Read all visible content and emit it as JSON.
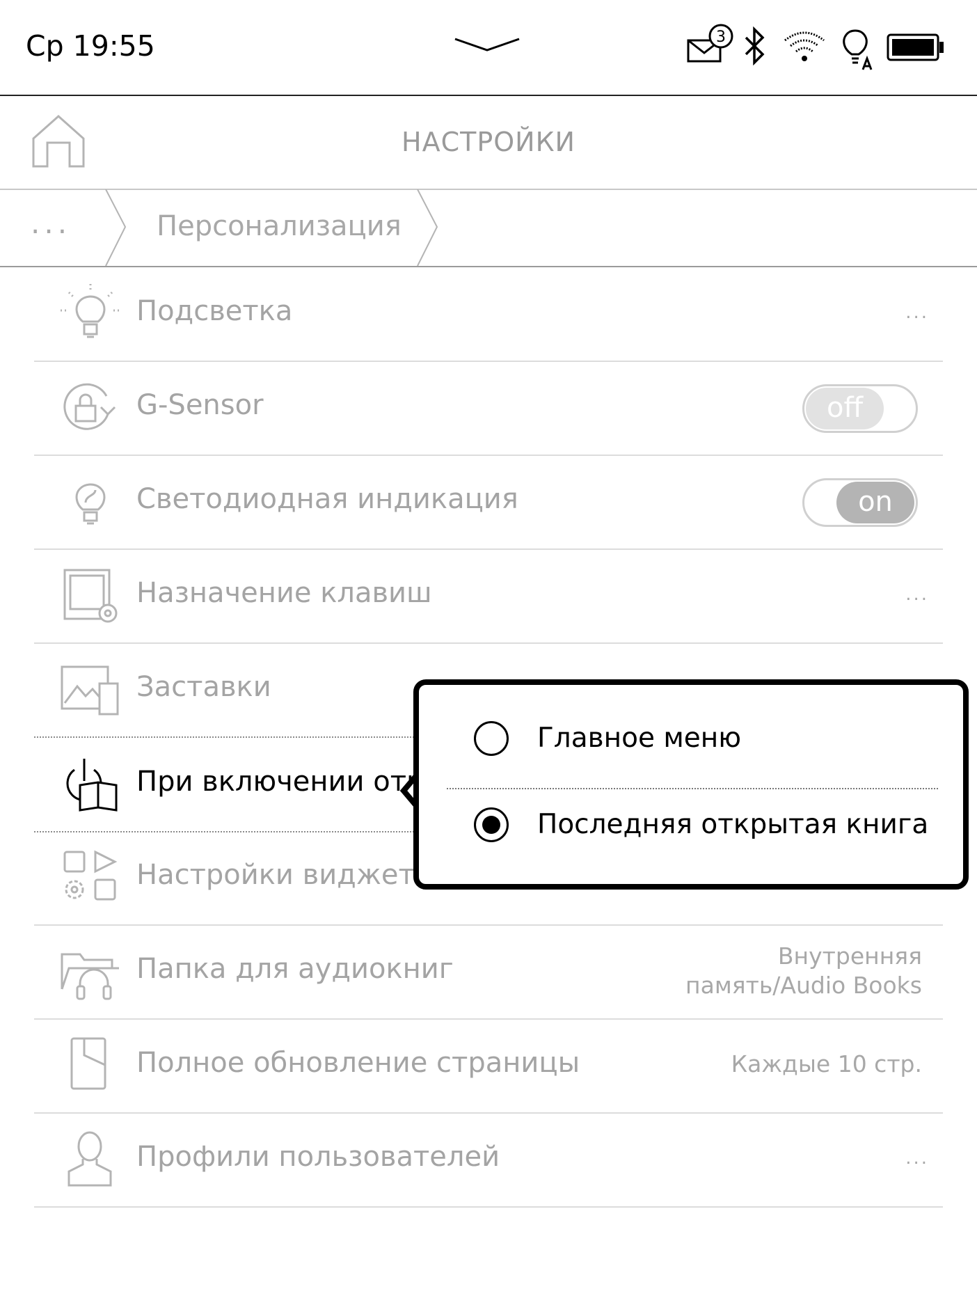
{
  "status": {
    "time": "Ср 19:55",
    "mail_count": "3"
  },
  "header": {
    "title": "НАСТРОЙКИ"
  },
  "breadcrumb": {
    "more": "...",
    "current": "Персонализация"
  },
  "settings": {
    "backlight": {
      "label": "Подсветка",
      "more": "..."
    },
    "gsensor": {
      "label": "G-Sensor",
      "toggle": "off"
    },
    "led": {
      "label": "Светодиодная индикация",
      "toggle": "on"
    },
    "keys": {
      "label": "Назначение клавиш",
      "more": "..."
    },
    "screensavers": {
      "label": "Заставки"
    },
    "on_power": {
      "label": "При включении открывать"
    },
    "widgets": {
      "label": "Настройки виджета"
    },
    "audio_folder": {
      "label": "Папка для аудиокниг",
      "value_line1": "Внутренняя",
      "value_line2": "память/Audio Books"
    },
    "refresh": {
      "label": "Полное обновление страницы",
      "value": "Каждые 10 стр."
    },
    "profiles": {
      "label": "Профили пользователей",
      "more": "..."
    }
  },
  "popup": {
    "options": [
      {
        "label": "Главное меню",
        "selected": false
      },
      {
        "label": "Последняя открытая книга",
        "selected": true
      }
    ]
  }
}
